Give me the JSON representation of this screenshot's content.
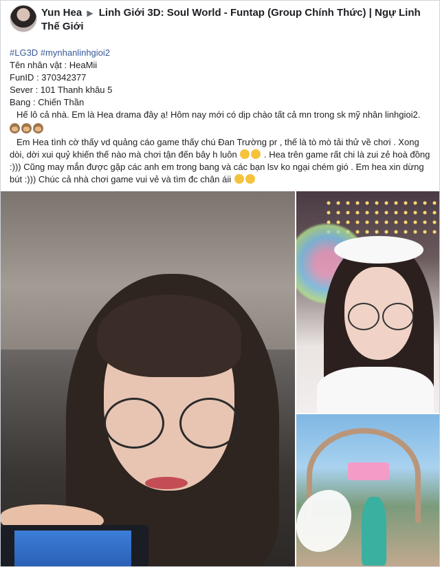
{
  "post": {
    "author": "Yun Hea",
    "group": "Linh Giới 3D: Soul World - Funtap (Group Chính Thức) | Ngự Linh Thế Giới",
    "hashtags": [
      "#LG3D",
      "#mynhanlinhgioi2"
    ],
    "fields": {
      "character": "Tên nhân vật : HeaMii",
      "funid": "FunID : 370342377",
      "server": "Sever : 101 Thanh khâu 5",
      "guild": "Bang : Chiến Thần"
    },
    "paragraph1": "Hế lô cả nhà. Em là Hea drama đây ạ! Hôm nay mới có dịp chào tất cả mn trong sk mỹ nhân linhgioi2.",
    "paragraph2a": "Em Hea tình cờ thấy vd quảng cáo game thấy chú Đan Trường pr , thế là tò mò tải thử về chơi . Xong dòi, dời xui quỷ khiến thế nào mà chơi tận đến bây h luôn",
    "paragraph2b": ". Hea trên game rất chi là zui zẻ hoà đồng :))) Cũng may mắn được gặp các anh em trong bang và các bạn lsv ko ngại chém gió . Em hea xin dừng bút :))) Chúc cả nhà chơi game vui vẻ và tìm đc chân áii"
  },
  "icons": {
    "arrow": "▶",
    "see_no_evil_monkey": "see-no-evil-monkey-icon",
    "laughing_tears": "tears-of-joy-icon",
    "smiling_face": "smiling-face-icon"
  }
}
